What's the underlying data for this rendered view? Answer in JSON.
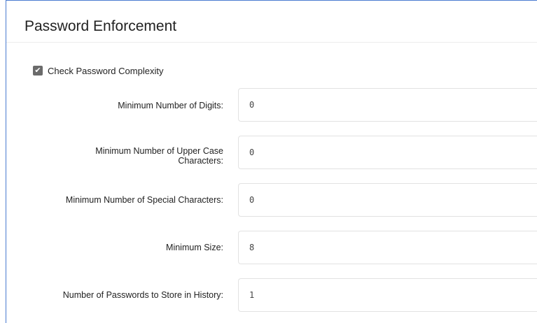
{
  "section": {
    "title": "Password Enforcement"
  },
  "complexity_check": {
    "label": "Check Password Complexity",
    "checked": true
  },
  "fields": [
    {
      "label": "Minimum Number of Digits:",
      "value": "0"
    },
    {
      "label": "Minimum Number of Upper Case Characters:",
      "value": "0"
    },
    {
      "label": "Minimum Number of Special Characters:",
      "value": "0"
    },
    {
      "label": "Minimum Size:",
      "value": "8"
    },
    {
      "label": "Number of Passwords to Store in History:",
      "value": "1"
    }
  ],
  "icons": {
    "checkbox": "checkmark-icon"
  }
}
